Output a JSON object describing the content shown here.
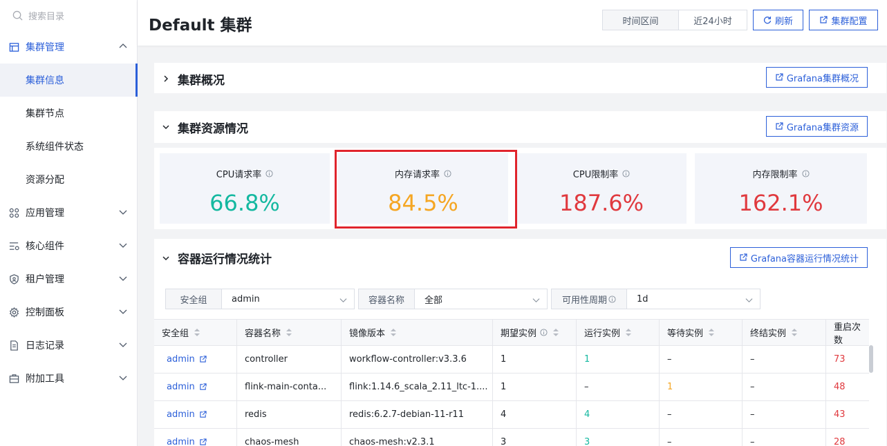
{
  "sidebar": {
    "search_placeholder": "搜索目录",
    "cluster_mgmt": {
      "label": "集群管理",
      "children": [
        "集群信息",
        "集群节点",
        "系统组件状态",
        "资源分配"
      ]
    },
    "menus": [
      {
        "label": "应用管理",
        "icon": "grid-icon"
      },
      {
        "label": "核心组件",
        "icon": "component-icon"
      },
      {
        "label": "租户管理",
        "icon": "shield-user-icon"
      },
      {
        "label": "控制面板",
        "icon": "gear-icon"
      },
      {
        "label": "日志记录",
        "icon": "document-icon"
      },
      {
        "label": "附加工具",
        "icon": "toolbox-icon"
      }
    ]
  },
  "header": {
    "title": "Default 集群",
    "time_label": "时间区间",
    "time_value": "近24小时",
    "refresh_label": "刷新",
    "config_label": "集群配置"
  },
  "sections": {
    "overview": {
      "title": "集群概况",
      "button": "Grafana集群概况"
    },
    "resources": {
      "title": "集群资源情况",
      "button": "Grafana集群资源"
    },
    "containers": {
      "title": "容器运行情况统计",
      "button": "Grafana容器运行情况统计"
    }
  },
  "stats": [
    {
      "label": "CPU请求率",
      "value": "66.8%",
      "color": "#14b8a0"
    },
    {
      "label": "内存请求率",
      "value": "84.5%",
      "color": "#f5a623"
    },
    {
      "label": "CPU限制率",
      "value": "187.6%",
      "color": "#e0393e"
    },
    {
      "label": "内存限制率",
      "value": "162.1%",
      "color": "#e0393e"
    }
  ],
  "filters": [
    {
      "label": "安全组",
      "value": "admin"
    },
    {
      "label": "容器名称",
      "value": "全部"
    },
    {
      "label": "可用性周期",
      "value": "1d"
    }
  ],
  "table": {
    "headers": [
      "安全组",
      "容器名称",
      "镜像版本",
      "期望实例",
      "运行实例",
      "等待实例",
      "终结实例",
      "重启次数"
    ],
    "rows": [
      [
        "admin",
        "controller",
        "workflow-controller:v3.3.6",
        "1",
        "1",
        "–",
        "–",
        "73"
      ],
      [
        "admin",
        "flink-main-conta...",
        "flink:1.14.6_scala_2.11_ltc-1....",
        "1",
        "–",
        "1",
        "–",
        "48"
      ],
      [
        "admin",
        "redis",
        "redis:6.2.7-debian-11-r11",
        "4",
        "4",
        "–",
        "–",
        "43"
      ],
      [
        "admin",
        "chaos-mesh",
        "chaos-mesh:v2.3.1",
        "3",
        "3",
        "–",
        "–",
        "28"
      ]
    ]
  },
  "colors": {
    "accent": "#2b5fd9",
    "green": "#14b8a0",
    "orange": "#f5a623",
    "red": "#e0393e"
  }
}
